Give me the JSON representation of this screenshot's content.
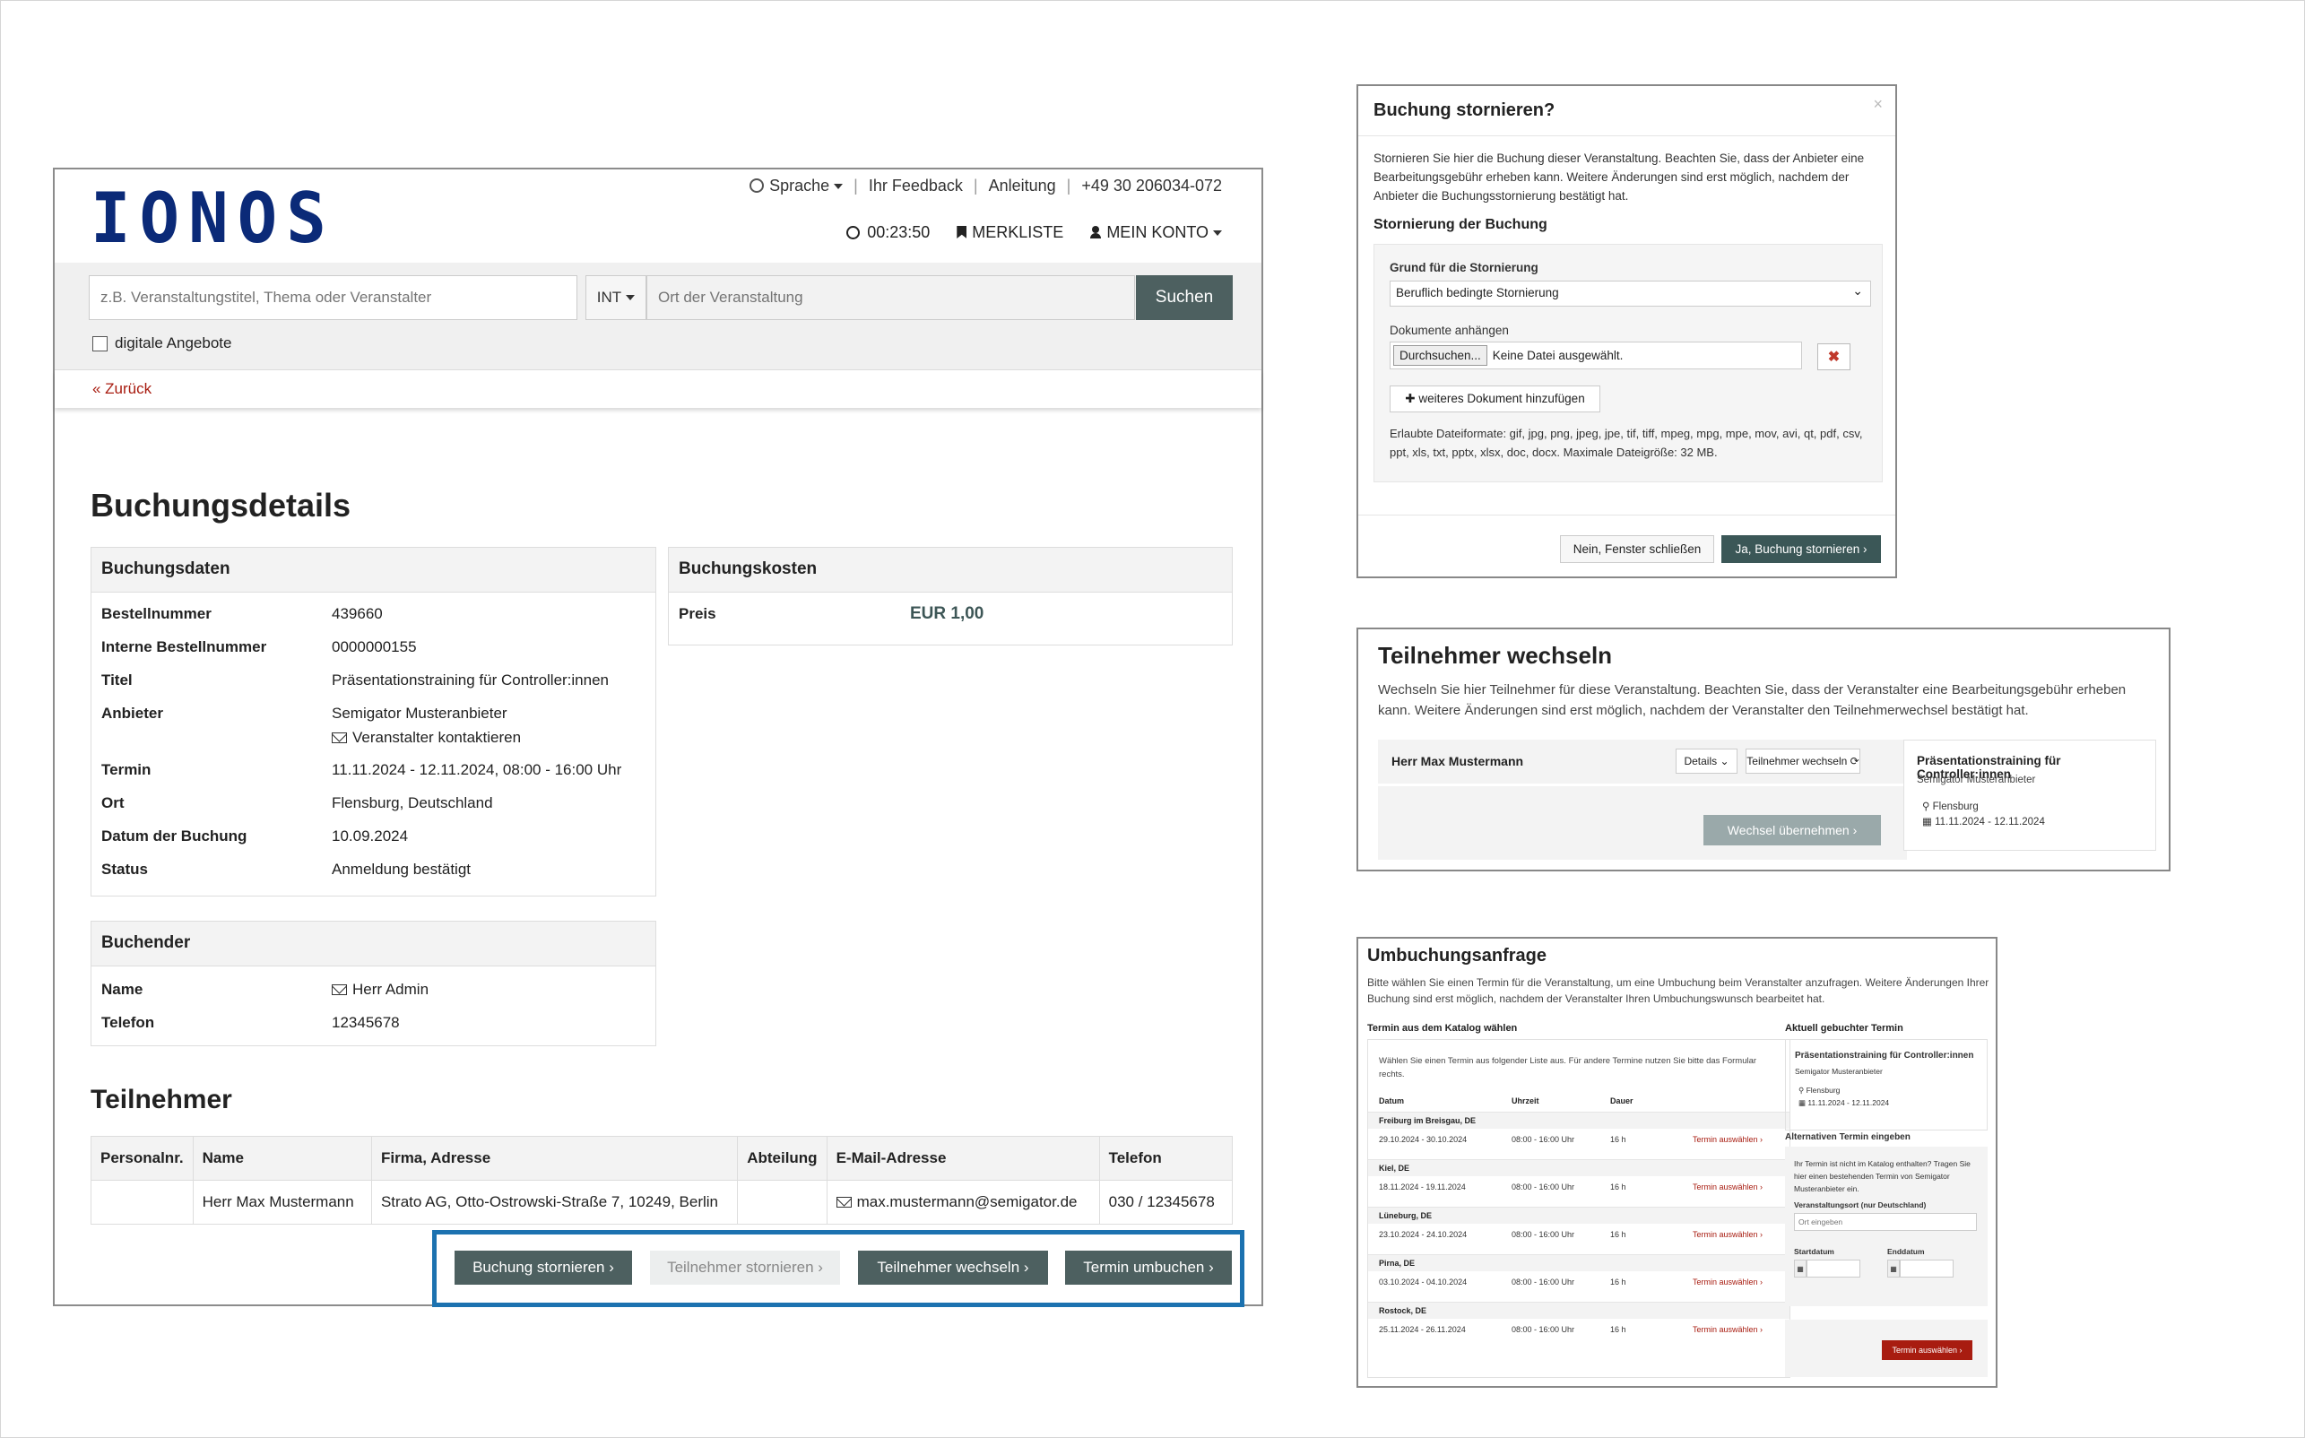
{
  "header": {
    "logo": "IONOS",
    "language": "Sprache",
    "feedback": "Ihr Feedback",
    "guide": "Anleitung",
    "phone": "+49 30 206034-072",
    "timer": "00:23:50",
    "watchlist": "MERKLISTE",
    "account": "MEIN KONTO"
  },
  "search": {
    "placeholder": "z.B. Veranstaltungstitel, Thema oder Veranstalter",
    "region": "INT",
    "place_placeholder": "Ort der Veranstaltung",
    "button": "Suchen",
    "digital_label": "digitale Angebote"
  },
  "back_link": "« Zurück",
  "page_title": "Buchungsdetails",
  "booking_data": {
    "title": "Buchungsdaten",
    "rows": [
      {
        "label": "Bestellnummer",
        "value": "439660"
      },
      {
        "label": "Interne Bestellnummer",
        "value": "0000000155"
      },
      {
        "label": "Titel",
        "value": "Präsentationstraining für Controller:innen"
      },
      {
        "label": "Anbieter",
        "value": "Semigator Musteranbieter"
      },
      {
        "label": "",
        "value": "Veranstalter kontaktieren"
      },
      {
        "label": "Termin",
        "value": "11.11.2024 - 12.11.2024, 08:00 - 16:00 Uhr"
      },
      {
        "label": "Ort",
        "value": "Flensburg, Deutschland"
      },
      {
        "label": "Datum der Buchung",
        "value": "10.09.2024"
      },
      {
        "label": "Status",
        "value": "Anmeldung bestätigt"
      }
    ]
  },
  "booking_costs": {
    "title": "Buchungskosten",
    "label": "Preis",
    "value": "EUR 1,00"
  },
  "booker": {
    "title": "Buchender",
    "rows": [
      {
        "label": "Name",
        "value": "Herr Admin"
      },
      {
        "label": "Telefon",
        "value": "12345678"
      }
    ]
  },
  "participants": {
    "title": "Teilnehmer",
    "headers": [
      "Personalnr.",
      "Name",
      "Firma, Adresse",
      "Abteilung",
      "E-Mail-Adresse",
      "Telefon"
    ],
    "row": [
      "",
      "Herr Max Mustermann",
      "Strato AG, Otto-Ostrowski-Straße 7, 10249, Berlin",
      "",
      "max.mustermann@semigator.de",
      "030 / 12345678"
    ]
  },
  "actions": {
    "cancel_booking": "Buchung stornieren ›",
    "cancel_participant": "Teilnehmer stornieren ›",
    "switch_participant": "Teilnehmer wechseln ›",
    "rebook": "Termin umbuchen ›"
  },
  "cancel_modal": {
    "title": "Buchung stornieren?",
    "close": "×",
    "text": "Stornieren Sie hier die Buchung dieser Veranstaltung. Beachten Sie, dass der Anbieter eine Bearbeitungsgebühr erheben kann. Weitere Änderungen sind erst möglich, nachdem der Anbieter die Buchungsstornierung bestätigt hat.",
    "subtitle": "Stornierung der Buchung",
    "reason_label": "Grund für die Stornierung",
    "reason_value": "Beruflich bedingte Stornierung",
    "docs_label": "Dokumente anhängen",
    "browse": "Durchsuchen...",
    "no_file": "Keine Datei ausgewählt.",
    "remove": "✖",
    "add_doc": "✚ weiteres Dokument hinzufügen",
    "formats": "Erlaubte Dateiformate: gif, jpg, png, jpeg, jpe, tif, tiff, mpeg, mpg, mpe, mov, avi, qt, pdf, csv, ppt, xls, txt, pptx, xlsx, doc, docx. Maximale Dateigröße: 32 MB.",
    "no_button": "Nein, Fenster schließen",
    "yes_button": "Ja, Buchung stornieren ›"
  },
  "switch_modal": {
    "title": "Teilnehmer wechseln",
    "text": "Wechseln Sie hier Teilnehmer für diese Veranstaltung. Beachten Sie, dass der Veranstalter eine Bearbeitungsgebühr erheben kann. Weitere Änderungen sind erst möglich, nachdem der Veranstalter den Teilnehmerwechsel bestätigt hat.",
    "participant": "Herr Max Mustermann",
    "details": "Details ⌄",
    "switch": "Teilnehmer wechseln ⟳",
    "apply": "Wechsel übernehmen ›",
    "event_title": "Präsentationstraining für Controller:innen",
    "event_provider": "Semigator Musteranbieter",
    "event_location": "Flensburg",
    "event_dates": "11.11.2024 - 12.11.2024"
  },
  "rebook_modal": {
    "title": "Umbuchungsanfrage",
    "text": "Bitte wählen Sie einen Termin für die Veranstaltung, um eine Umbuchung beim Veranstalter anzufragen. Weitere Änderungen Ihrer Buchung sind erst möglich, nachdem der Veranstalter Ihren Umbuchungswunsch bearbeitet hat.",
    "left_heading": "Termin aus dem Katalog wählen",
    "intro": "Wählen Sie einen Termin aus folgender Liste aus. Für andere Termine nutzen Sie bitte das Formular rechts.",
    "col_date": "Datum",
    "col_time": "Uhrzeit",
    "col_duration": "Dauer",
    "groups": [
      {
        "city": "Freiburg im Breisgau, DE",
        "date": "29.10.2024 - 30.10.2024",
        "time": "08:00 - 16:00 Uhr",
        "duration": "16 h",
        "link": "Termin auswählen ›"
      },
      {
        "city": "Kiel, DE",
        "date": "18.11.2024 - 19.11.2024",
        "time": "08:00 - 16:00 Uhr",
        "duration": "16 h",
        "link": "Termin auswählen ›"
      },
      {
        "city": "Lüneburg, DE",
        "date": "23.10.2024 - 24.10.2024",
        "time": "08:00 - 16:00 Uhr",
        "duration": "16 h",
        "link": "Termin auswählen ›"
      },
      {
        "city": "Pirna, DE",
        "date": "03.10.2024 - 04.10.2024",
        "time": "08:00 - 16:00 Uhr",
        "duration": "16 h",
        "link": "Termin auswählen ›"
      },
      {
        "city": "Rostock, DE",
        "date": "25.11.2024 - 26.11.2024",
        "time": "08:00 - 16:00 Uhr",
        "duration": "16 h",
        "link": "Termin auswählen ›"
      }
    ],
    "right_heading": "Aktuell gebuchter Termin",
    "cur_title": "Präsentationstraining für Controller:innen",
    "cur_provider": "Semigator Musteranbieter",
    "cur_location": "Flensburg",
    "cur_dates": "11.11.2024 - 12.11.2024",
    "alt_heading": "Alternativen Termin eingeben",
    "alt_text": "Ihr Termin ist nicht im Katalog enthalten? Tragen Sie hier einen bestehenden Termin von Semigator Musteranbieter ein.",
    "alt_place_label": "Veranstaltungsort (nur Deutschland)",
    "alt_place_placeholder": "Ort eingeben",
    "start_label": "Startdatum",
    "end_label": "Enddatum",
    "select_button": "Termin auswählen ›"
  }
}
